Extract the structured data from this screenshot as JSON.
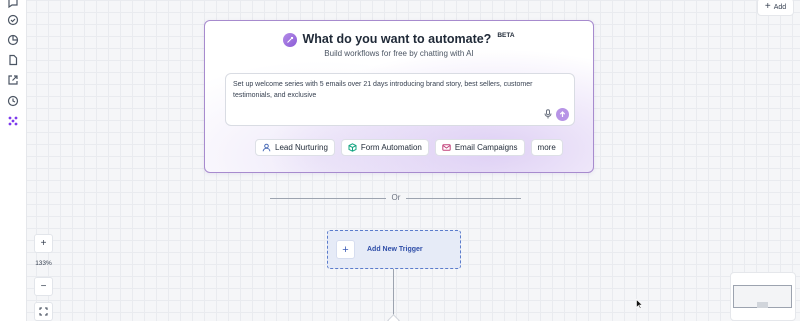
{
  "toolbar": {
    "add_label": "Add"
  },
  "sidebar": {
    "icons": [
      "chat-icon",
      "check-circle-icon",
      "pie-chart-icon",
      "file-icon",
      "share-icon",
      "history-icon",
      "workflow-icon"
    ]
  },
  "ai_builder": {
    "title": "What do you want to automate?",
    "badge": "BETA",
    "subtitle": "Build workflows for free by chatting with AI",
    "prompt_text": "Set up welcome series with 5 emails over 21 days introducing brand story, best sellers, customer testimonials, and exclusive",
    "accent_color": "#a78bce",
    "chips": [
      {
        "label": "Lead Nurturing",
        "icon": "user-icon"
      },
      {
        "label": "Form Automation",
        "icon": "cube-icon"
      },
      {
        "label": "Email Campaigns",
        "icon": "mail-icon"
      },
      {
        "label": "more",
        "icon": ""
      }
    ]
  },
  "divider": {
    "label": "Or"
  },
  "trigger": {
    "label": "Add New Trigger",
    "accent_color": "#2f4ea8"
  },
  "zoom": {
    "level": "133%",
    "in_label": "+",
    "out_label": "−"
  }
}
